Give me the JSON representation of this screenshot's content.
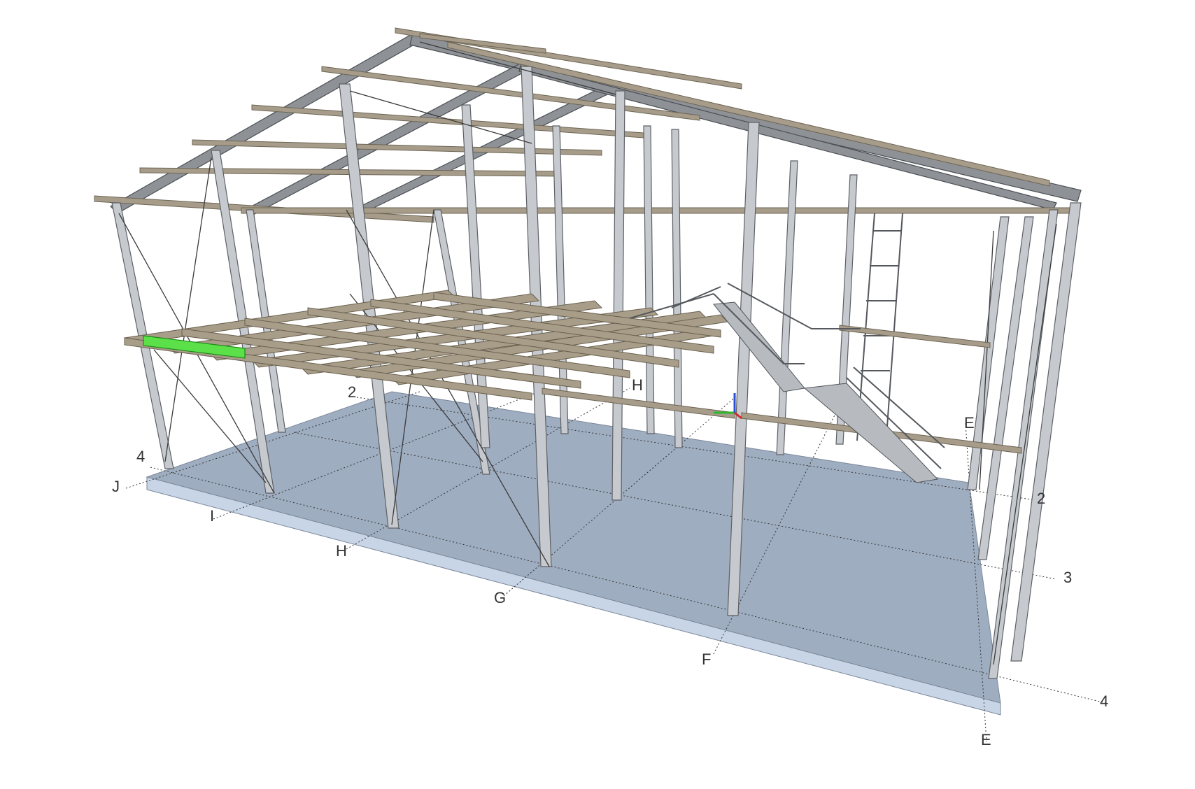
{
  "viewer": {
    "selection_color": "#5ce04a",
    "slab_color": "#9fadc0",
    "steel_color": "#c6c9cd",
    "timber_color": "#a69c89"
  },
  "grid_labels": {
    "letters": {
      "J": "J",
      "I": "I",
      "H_front": "H",
      "H_back": "H",
      "G": "G",
      "F": "F",
      "E_top": "E",
      "E_bottom": "E"
    },
    "numbers": {
      "n4_left": "4",
      "n2_left": "2",
      "n2_right": "2",
      "n3_right": "3",
      "n4_right": "4"
    }
  },
  "axis_gizmo": {
    "x_color": "#2eb82e",
    "y_color": "#2a4fd6",
    "z_color": "#d62a2a"
  }
}
